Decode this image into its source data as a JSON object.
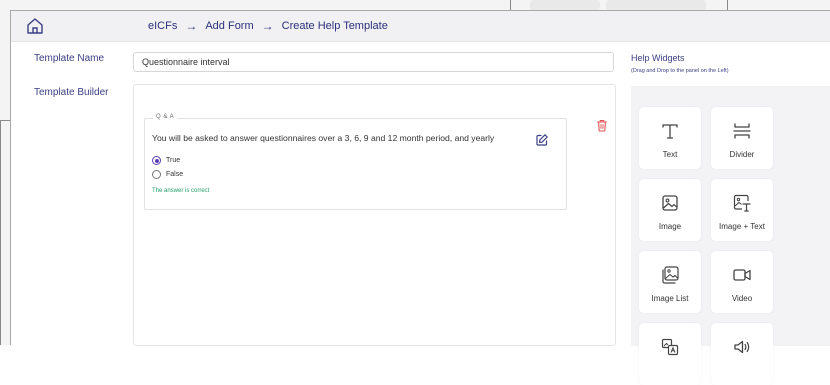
{
  "breadcrumb": {
    "items": [
      "eICFs",
      "Add Form",
      "Create Help Template"
    ],
    "separator": "→"
  },
  "form": {
    "template_name_label": "Template Name",
    "template_name_value": "Questionnaire interval",
    "template_builder_label": "Template Builder"
  },
  "qa_card": {
    "legend": "Q & A",
    "question": "You will be asked to answer questionnaires over a 3, 6, 9 and 12 month period, and yearly",
    "options": [
      {
        "label": "True",
        "selected": true
      },
      {
        "label": "False",
        "selected": false
      }
    ],
    "answer_status": "The answer is correct"
  },
  "widgets": {
    "title": "Help Widgets",
    "subtitle": "(Drag and Drop to the panel on the Left)",
    "items": [
      {
        "label": "Text",
        "icon": "text-icon"
      },
      {
        "label": "Divider",
        "icon": "divider-icon"
      },
      {
        "label": "Image",
        "icon": "image-icon"
      },
      {
        "label": "Image + Text",
        "icon": "image-text-icon"
      },
      {
        "label": "Image List",
        "icon": "image-list-icon"
      },
      {
        "label": "Video",
        "icon": "video-icon"
      },
      {
        "label": "",
        "icon": "image-caption-icon"
      },
      {
        "label": "",
        "icon": "audio-icon"
      }
    ]
  },
  "colors": {
    "accent": "#3b3f84",
    "radio_selected": "#5a3fb8",
    "success": "#27a06b",
    "delete": "#e05555"
  }
}
